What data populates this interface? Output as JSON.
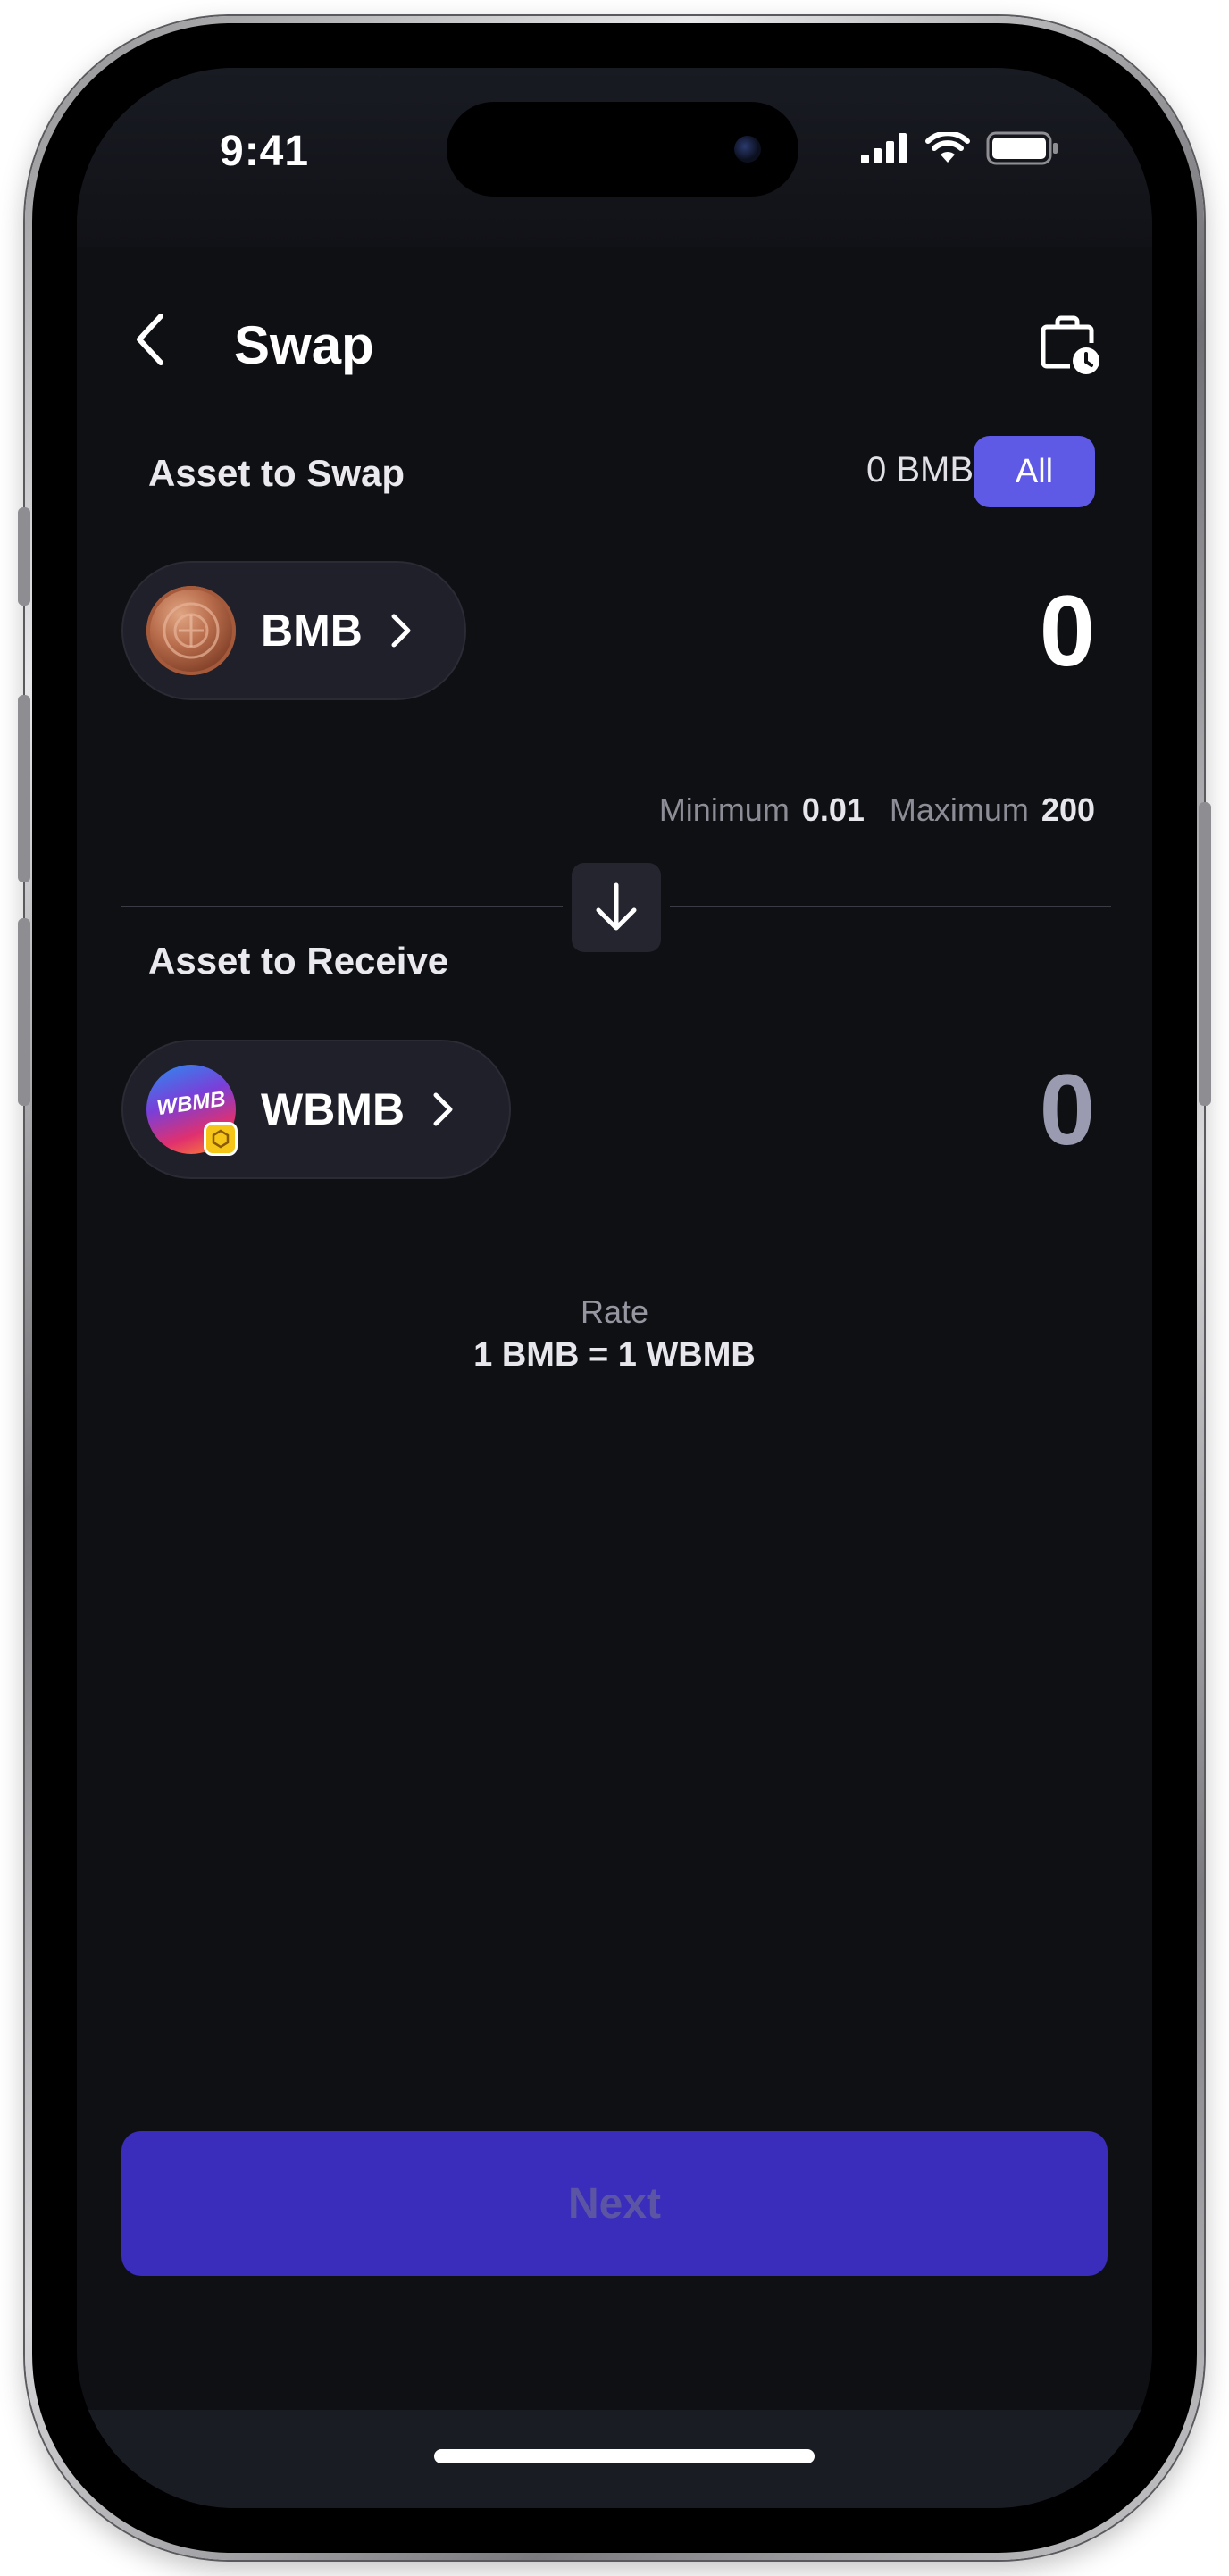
{
  "status_bar": {
    "time": "9:41",
    "icons": [
      "cellular-signal-icon",
      "wifi-icon",
      "battery-icon"
    ]
  },
  "header": {
    "title": "Swap",
    "back_icon": "chevron-left-icon",
    "history_icon": "bag-clock-icon"
  },
  "from": {
    "label": "Asset to Swap",
    "balance": "0 BMB",
    "all_label": "All",
    "token": "BMB",
    "amount": "0",
    "minimum_label": "Minimum",
    "minimum_value": "0.01",
    "maximum_label": "Maximum",
    "maximum_value": "200"
  },
  "to": {
    "label": "Asset to Receive",
    "token": "WBMB",
    "token_logo_text": "WBMB",
    "amount": "0"
  },
  "rate": {
    "label": "Rate",
    "value": "1 BMB = 1 WBMB"
  },
  "actions": {
    "next_label": "Next"
  },
  "colors": {
    "background": "#0f1014",
    "accent": "#5f5ae6",
    "primary_button": "#3b2dbb",
    "primary_button_text_disabled": "#5c55a4",
    "pill": "#1f2029",
    "muted_text": "#8c8d96",
    "receive_amount": "#9a9bb0"
  }
}
